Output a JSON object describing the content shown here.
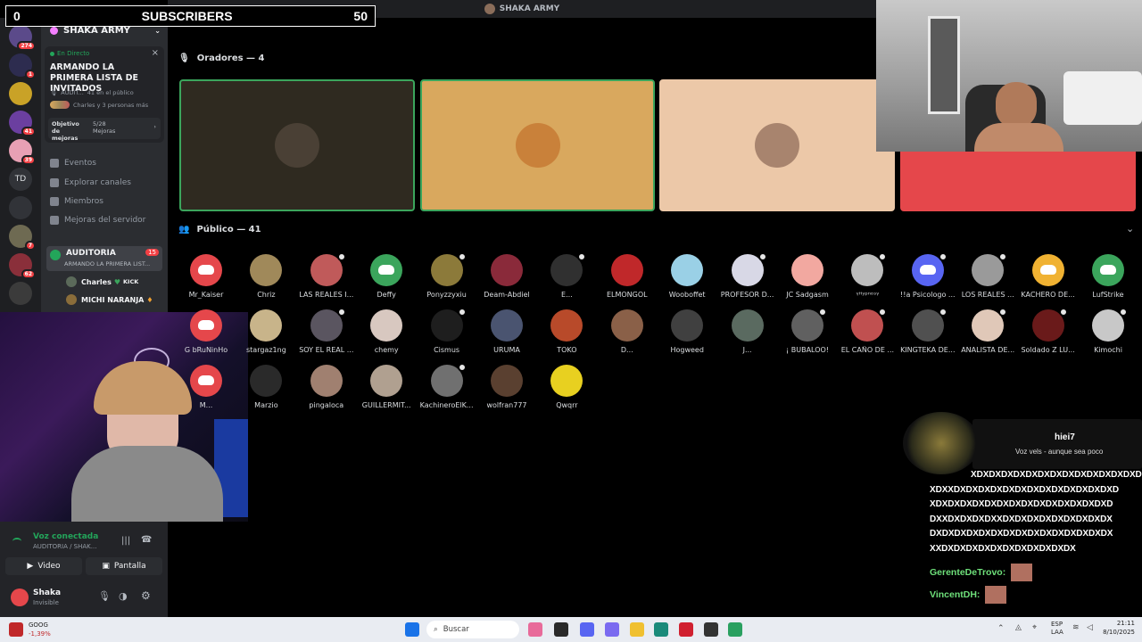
{
  "overlay": {
    "subs_left": "0",
    "subs_label": "SUBSCRIBERS",
    "subs_right": "50"
  },
  "topbar": {
    "title": "SHAKA ARMY"
  },
  "rail": {
    "items": [
      {
        "badge": "274",
        "color": "#5b4a8a"
      },
      {
        "badge": "1",
        "color": "#2d2c4f"
      },
      {
        "badge": "",
        "color": "#c9a227"
      },
      {
        "badge": "41",
        "color": "#6b3fa0"
      },
      {
        "badge": "39",
        "color": "#e8a0b4"
      },
      {
        "badge": "",
        "color": "#313338",
        "text": "TD"
      },
      {
        "badge": "",
        "color": "#313338"
      },
      {
        "badge": "7",
        "color": "#6e6a52"
      },
      {
        "badge": "62",
        "color": "#8a2f3a"
      },
      {
        "badge": "",
        "color": "#3b3b3b"
      }
    ]
  },
  "sidebar": {
    "server_name": "SHAKA ARMY",
    "live_label": "En Directo",
    "event_title": "ARMANDO LA PRIMERA LISTA DE INVITADOS",
    "event_channel": "AUDIT...",
    "event_listeners": "41 en el público",
    "event_people": "Charles y 3 personas más",
    "boost_label": "Objetivo de mejoras",
    "boost_progress": "5/28 Mejoras",
    "items": [
      "Eventos",
      "Explorar canales",
      "Miembros",
      "Mejoras del servidor"
    ],
    "stage_channel": "AUDITORIA",
    "stage_count": "15",
    "stage_topic": "ARMANDO LA PRIMERA LIST...",
    "members": [
      {
        "name": "Charles",
        "tag": "KICK"
      },
      {
        "name": "MICHI NARANJA"
      }
    ]
  },
  "voice": {
    "status": "Voz conectada",
    "channel": "AUDITORIA / SHAK...",
    "video_label": "Video",
    "screen_label": "Pantalla",
    "user_name": "Shaka",
    "user_status": "Invisible"
  },
  "stage": {
    "speakers_label": "Oradores — 4",
    "public_label": "Público — 41",
    "speakers": [
      {
        "bg": "#2f2a20",
        "border": "#3ba55c",
        "pic": "#4a4035"
      },
      {
        "bg": "#d9a85e",
        "border": "#3ba55c",
        "pic": "#c9813a"
      },
      {
        "bg": "#ecc8a8",
        "border": "#ecc8a8",
        "pic": "#a8846e"
      },
      {
        "bg": "#e5474b",
        "border": "#e5474b",
        "pic": ""
      }
    ]
  },
  "audience": [
    {
      "name": "Mr_Kaiser",
      "color": "#e5474b",
      "discord": true,
      "status": false
    },
    {
      "name": "Chriz",
      "color": "#a0895a",
      "discord": false,
      "status": false
    },
    {
      "name": "LAS REALES I...",
      "color": "#c05a5a",
      "discord": false,
      "status": true
    },
    {
      "name": "Deffy",
      "color": "#3ba55c",
      "discord": true,
      "status": false
    },
    {
      "name": "Ponyzzyxiu",
      "color": "#8c7a3a",
      "discord": false,
      "status": true
    },
    {
      "name": "Deam-Abdiel",
      "color": "#8a2a3a",
      "discord": false,
      "status": false
    },
    {
      "name": "E...",
      "color": "#303030",
      "discord": false,
      "status": true
    },
    {
      "name": "ELMONGOL",
      "color": "#c0282a",
      "discord": false,
      "status": false
    },
    {
      "name": "Wooboffet",
      "color": "#9ad0e6",
      "discord": false,
      "status": false
    },
    {
      "name": "PROFESOR D...",
      "color": "#d8d8e6",
      "discord": false,
      "status": true
    },
    {
      "name": "JC Sadgasm",
      "color": "#f2a8a0",
      "discord": false,
      "status": false
    },
    {
      "name": "ᵞᴴʸᵖⁿᵒˢᵞ",
      "color": "#bdbdbd",
      "discord": false,
      "status": true
    },
    {
      "name": "!!a Psicologo ...",
      "color": "#5865f2",
      "discord": true,
      "status": true
    },
    {
      "name": "LOS REALES ...",
      "color": "#9a9a9a",
      "discord": false,
      "status": true
    },
    {
      "name": "KACHERO DE...",
      "color": "#f0b232",
      "discord": true,
      "status": false
    },
    {
      "name": "LufStrike",
      "color": "#3ba55c",
      "discord": true,
      "status": false
    },
    {
      "name": "G bRuNinHo",
      "color": "#e5474b",
      "discord": true,
      "status": false
    },
    {
      "name": "stargaz1ng",
      "color": "#c8b48a",
      "discord": false,
      "status": false
    },
    {
      "name": "SOY EL REAL ...",
      "color": "#5a5560",
      "discord": false,
      "status": true
    },
    {
      "name": "chemy",
      "color": "#d8c8c0",
      "discord": false,
      "status": false
    },
    {
      "name": "Cismus",
      "color": "#1e1e1e",
      "discord": false,
      "status": true
    },
    {
      "name": "URUMA",
      "color": "#4a5470",
      "discord": false,
      "status": false
    },
    {
      "name": "TOKO",
      "color": "#b84a2a",
      "discord": false,
      "status": false
    },
    {
      "name": "D...",
      "color": "#8a6048",
      "discord": false,
      "status": false
    },
    {
      "name": "Hogweed",
      "color": "#404040",
      "discord": false,
      "status": false
    },
    {
      "name": "J...",
      "color": "#5a6a60",
      "discord": false,
      "status": false
    },
    {
      "name": "¡ BUBALOO!",
      "color": "#606060",
      "discord": false,
      "status": true
    },
    {
      "name": "EL CAÑO DE ...",
      "color": "#c05050",
      "discord": false,
      "status": true
    },
    {
      "name": "KINGTEKA DE...",
      "color": "#505050",
      "discord": false,
      "status": true
    },
    {
      "name": "ANALISTA DE...",
      "color": "#e0c8b8",
      "discord": false,
      "status": true
    },
    {
      "name": "Soldado Z LU...",
      "color": "#6a1a1a",
      "discord": false,
      "status": true
    },
    {
      "name": "Kimochi",
      "color": "#c8c8c8",
      "discord": false,
      "status": true
    },
    {
      "name": "M...",
      "color": "#e5474b",
      "discord": true,
      "status": false
    },
    {
      "name": "Marzio",
      "color": "#2a2a2a",
      "discord": false,
      "status": false
    },
    {
      "name": "pingaloca",
      "color": "#a08070",
      "discord": false,
      "status": false
    },
    {
      "name": "GUILLERMIT...",
      "color": "#b0a090",
      "discord": false,
      "status": false
    },
    {
      "name": "KachineroElK...",
      "color": "#707070",
      "discord": false,
      "status": true
    },
    {
      "name": "wolfran777",
      "color": "#5a4030",
      "discord": false,
      "status": false
    },
    {
      "name": "Qwqrr",
      "color": "#e8d020",
      "discord": false,
      "status": false
    }
  ],
  "chat": {
    "card_name": "hiei7",
    "card_msg": "Voz vels - aunque sea poco",
    "spam_lines": [
      "XDXDXDXDXDXDXDXDXDXDXDXDXDXD",
      "XDXXDXDXDXDXDXDXDXDXDXDXDXDXDXD",
      "XDXDXDXDXDXDXDXDXDXDXDXDXDXDXD",
      "DXXDXDXDXDXXDXDXDXDXDXDXDXDXDX",
      "DXDXDXDXDXDXDXDXDXDXDXDXDXDXDX",
      "XXDXDXDXDXDXDXDXDXDXDXDX"
    ],
    "msgs": [
      {
        "user": "GerenteDeTrovo:"
      },
      {
        "user": "VincentDH:"
      }
    ]
  },
  "taskbar": {
    "stock_symbol": "GOOG",
    "stock_change": "-1,39%",
    "search_placeholder": "Buscar",
    "lang_top": "ESP",
    "lang_bottom": "LAA",
    "time": "21:11",
    "date": "8/10/2025"
  }
}
